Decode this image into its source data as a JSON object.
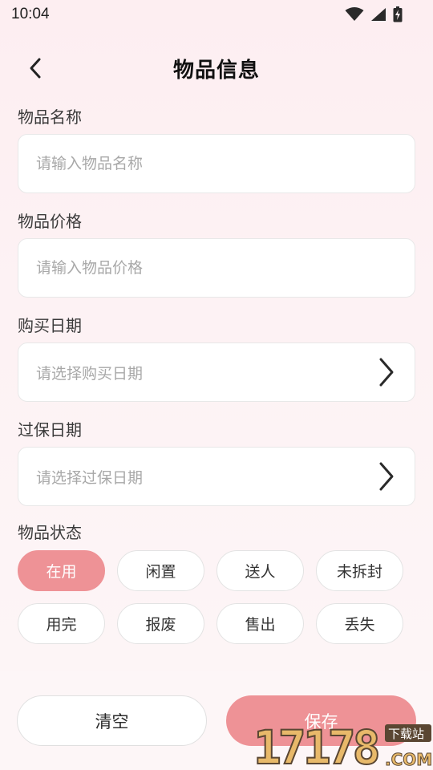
{
  "status_bar": {
    "time": "10:04"
  },
  "header": {
    "title": "物品信息"
  },
  "form": {
    "name": {
      "label": "物品名称",
      "placeholder": "请输入物品名称"
    },
    "price": {
      "label": "物品价格",
      "placeholder": "请输入物品价格"
    },
    "purchase_date": {
      "label": "购买日期",
      "placeholder": "请选择购买日期"
    },
    "warranty_date": {
      "label": "过保日期",
      "placeholder": "请选择过保日期"
    },
    "status": {
      "label": "物品状态",
      "selected": "在用",
      "options": [
        "在用",
        "闲置",
        "送人",
        "未拆封",
        "用完",
        "报废",
        "售出",
        "丢失"
      ]
    }
  },
  "buttons": {
    "clear": "清空",
    "save": "保存"
  },
  "watermark": {
    "text": "17178",
    "suffix": ".COM",
    "badge": "下载站"
  },
  "colors": {
    "accent": "#ee9296",
    "background": "#fdeef1"
  }
}
